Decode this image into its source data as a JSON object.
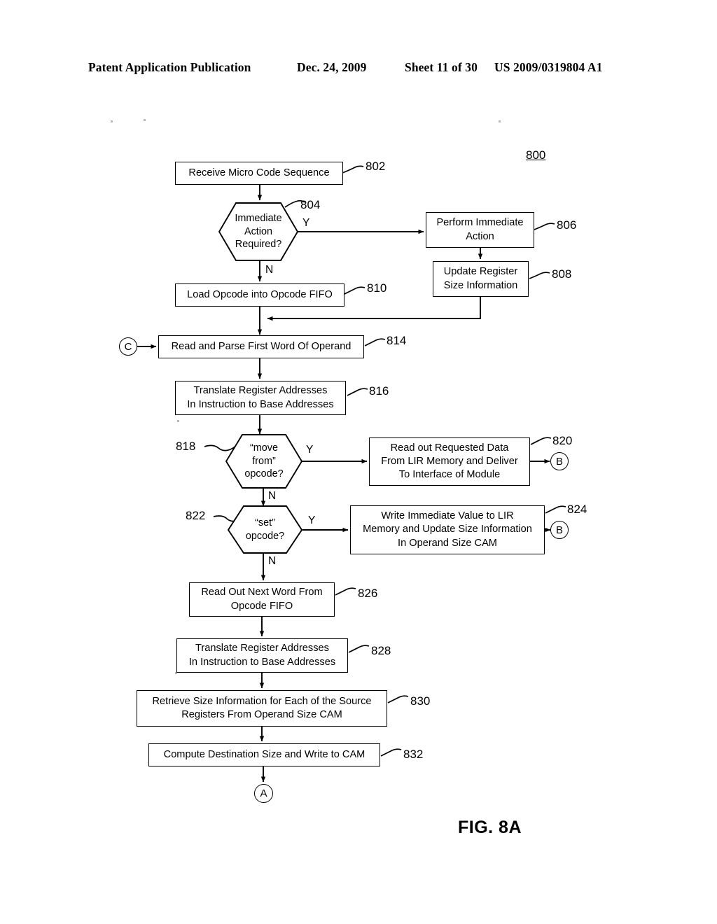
{
  "header": {
    "publication": "Patent Application Publication",
    "date": "Dec. 24, 2009",
    "sheet": "Sheet 11 of 30",
    "patent_number": "US 2009/0319804 A1"
  },
  "figure": {
    "caption": "FIG. 8A",
    "diagram_number": "800"
  },
  "nodes": {
    "n802": {
      "label": "Receive Micro Code Sequence",
      "ref": "802"
    },
    "n804": {
      "label": "Immediate\nAction\nRequired?",
      "ref": "804"
    },
    "n806": {
      "label": "Perform Immediate\nAction",
      "ref": "806"
    },
    "n808": {
      "label": "Update Register\nSize Information",
      "ref": "808"
    },
    "n810": {
      "label": "Load Opcode into Opcode FIFO",
      "ref": "810"
    },
    "n814": {
      "label": "Read and Parse First Word Of Operand",
      "ref": "814"
    },
    "n816": {
      "label": "Translate Register Addresses\nIn Instruction to Base Addresses",
      "ref": "816"
    },
    "n818": {
      "label": "“move\nfrom”\nopcode?",
      "ref": "818"
    },
    "n820": {
      "label": "Read out Requested Data\nFrom LIR Memory and Deliver\nTo Interface of Module",
      "ref": "820"
    },
    "n822": {
      "label": "“set”\nopcode?",
      "ref": "822"
    },
    "n824": {
      "label": "Write Immediate Value to LIR\nMemory and Update Size Information\nIn Operand Size CAM",
      "ref": "824"
    },
    "n826": {
      "label": "Read Out Next Word From\nOpcode FIFO",
      "ref": "826"
    },
    "n828": {
      "label": "Translate Register Addresses\nIn Instruction to Base Addresses",
      "ref": "828"
    },
    "n830": {
      "label": "Retrieve Size Information for Each of the Source\nRegisters From Operand Size CAM",
      "ref": "830"
    },
    "n832": {
      "label": "Compute Destination Size and Write to CAM",
      "ref": "832"
    }
  },
  "connectors": {
    "entry_c": "C",
    "exit_b_820": "B",
    "exit_b_824": "B",
    "exit_a": "A"
  },
  "branch_labels": {
    "b804_yes": "Y",
    "b804_no": "N",
    "b818_yes": "Y",
    "b818_no": "N",
    "b822_yes": "Y",
    "b822_no": "N"
  },
  "colors": {
    "ink": "#000000",
    "paper": "#ffffff"
  }
}
